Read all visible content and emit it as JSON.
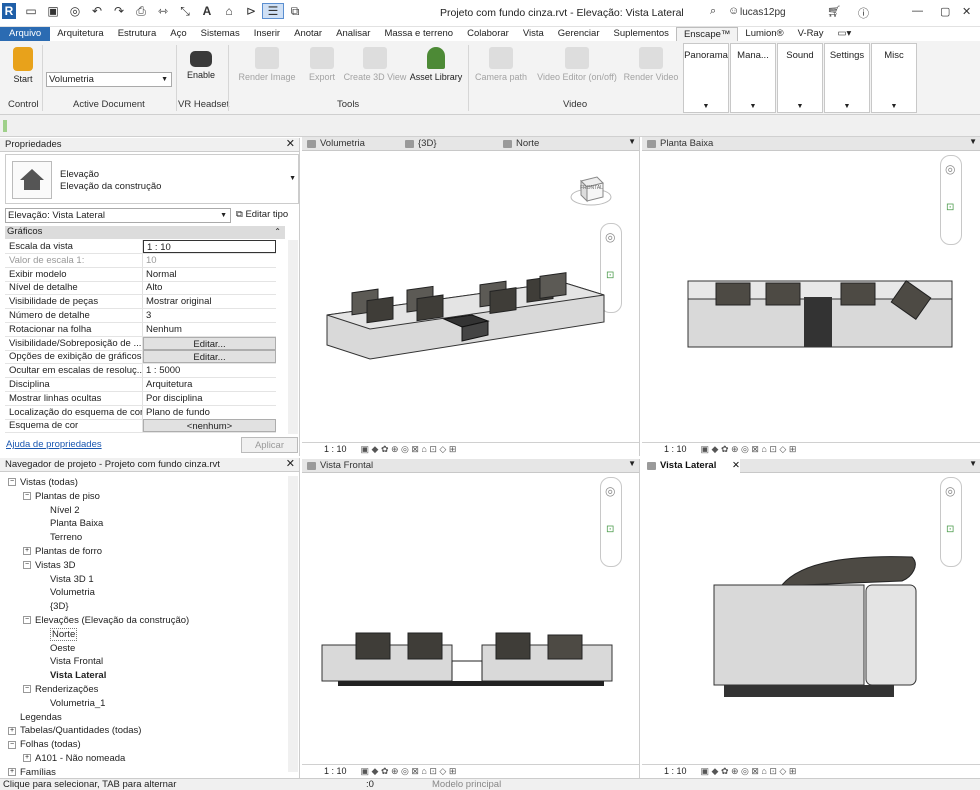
{
  "app": {
    "title": "Projeto com fundo cinza.rvt - Elevação: Vista Lateral",
    "user": "lucas12pg"
  },
  "ribbon_tabs": [
    "Arquivo",
    "Arquitetura",
    "Estrutura",
    "Aço",
    "Sistemas",
    "Inserir",
    "Anotar",
    "Analisar",
    "Massa e terreno",
    "Colaborar",
    "Vista",
    "Gerenciar",
    "Suplementos",
    "Enscape™",
    "Lumion®",
    "V-Ray"
  ],
  "ribbon": {
    "start": "Start",
    "active_doc_value": "Volumetria",
    "enable": "Enable",
    "render_image": "Render Image",
    "export": "Export",
    "create_3d": "Create 3D View",
    "asset_library": "Asset Library",
    "camera_path": "Camera path",
    "video_editor": "Video Editor (on/off)",
    "render_video": "Render Video",
    "panorama": "Panorama",
    "mana": "Mana...",
    "sound": "Sound",
    "settings": "Settings",
    "misc": "Misc",
    "groups": {
      "control": "Control",
      "active_document": "Active Document",
      "vr": "VR Headset",
      "tools": "Tools",
      "video": "Video"
    }
  },
  "properties": {
    "title": "Propriedades",
    "type_line1": "Elevação",
    "type_line2": "Elevação da construção",
    "selector": "Elevação: Vista Lateral",
    "edit_type": "Editar tipo",
    "section": "Gráficos",
    "rows": [
      {
        "k": "Escala da vista",
        "v": "1 : 10"
      },
      {
        "k": "Valor de escala    1:",
        "v": "10"
      },
      {
        "k": "Exibir modelo",
        "v": "Normal"
      },
      {
        "k": "Nível de detalhe",
        "v": "Alto"
      },
      {
        "k": "Visibilidade de peças",
        "v": "Mostrar original"
      },
      {
        "k": "Número de detalhe",
        "v": "3"
      },
      {
        "k": "Rotacionar na folha",
        "v": "Nenhum"
      },
      {
        "k": "Visibilidade/Sobreposição de ...",
        "v": "Editar..."
      },
      {
        "k": "Opções de exibição de gráficos",
        "v": "Editar..."
      },
      {
        "k": "Ocultar em escalas de resoluç...",
        "v": "1 : 5000"
      },
      {
        "k": "Disciplina",
        "v": "Arquitetura"
      },
      {
        "k": "Mostrar linhas ocultas",
        "v": "Por disciplina"
      },
      {
        "k": "Localização do esquema de cor",
        "v": "Plano de fundo"
      },
      {
        "k": "Esquema de cor",
        "v": "<nenhum>"
      }
    ],
    "help_link": "Ajuda de propriedades",
    "apply": "Aplicar"
  },
  "browser": {
    "title": "Navegador de projeto - Projeto com fundo cinza.rvt",
    "items": [
      "Vistas (todas)",
      "Plantas de piso",
      "Nível 2",
      "Planta Baixa",
      "Terreno",
      "Plantas de forro",
      "Vistas 3D",
      "Vista 3D 1",
      "Volumetria",
      "{3D}",
      "Elevações (Elevação da construção)",
      "Norte",
      "Oeste",
      "Vista Frontal",
      "Vista Lateral",
      "Renderizações",
      "Volumetria_1",
      "Legendas",
      "Tabelas/Quantidades (todas)",
      "Folhas (todas)",
      "A101 - Não nomeada",
      "Famílias"
    ]
  },
  "views": {
    "tl_tabs": [
      "Volumetria",
      "{3D}",
      "Norte"
    ],
    "tr_tab": "Planta Baixa",
    "bl_tab": "Vista Frontal",
    "br_tab": "Vista Lateral",
    "scale": "1 : 10",
    "viewcube_label": "FRONTAL"
  },
  "status": {
    "hint": "Clique para selecionar, TAB para alternar",
    "zero": ":0",
    "model": "Modelo principal"
  },
  "colors": {
    "accent": "#2b6bb2",
    "sofa": "#d9d9d9",
    "pillow": "#4d4a44",
    "dark": "#333333"
  }
}
